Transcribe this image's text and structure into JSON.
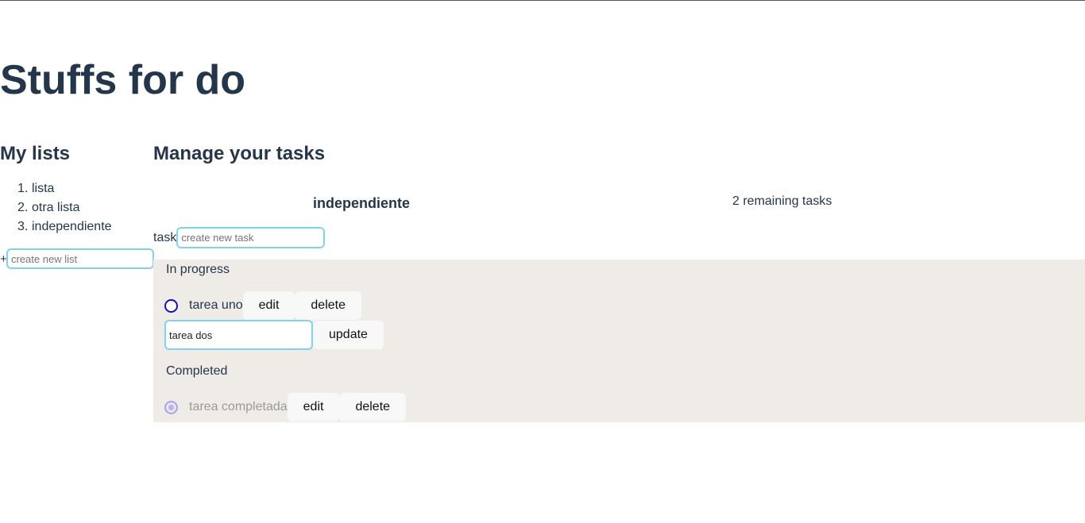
{
  "app": {
    "title": "Stuffs for do"
  },
  "sidebar": {
    "title": "My lists",
    "items": [
      {
        "number": "1.",
        "label": "lista"
      },
      {
        "number": "2.",
        "label": "otra lista"
      },
      {
        "number": "3.",
        "label": "independiente"
      }
    ],
    "new_list": {
      "prefix": "+",
      "placeholder": "create new list",
      "value": ""
    }
  },
  "main": {
    "title": "Manage your tasks",
    "list_name": "independiente",
    "remaining": "2 remaining tasks",
    "new_task": {
      "label": "task",
      "placeholder": "create new task",
      "value": ""
    },
    "in_progress": {
      "label": "In progress",
      "tasks": [
        {
          "text": "tarea uno",
          "edit_label": "edit",
          "delete_label": "delete"
        }
      ],
      "editing": {
        "value": "tarea dos",
        "update_label": "update"
      }
    },
    "completed": {
      "label": "Completed",
      "tasks": [
        {
          "text": "tarea completada",
          "edit_label": "edit",
          "delete_label": "delete"
        }
      ]
    }
  },
  "colors": {
    "heading": "#24364b",
    "panel_bg": "#efece8",
    "input_border": "#7fd3ea",
    "radio_active": "#1010c8",
    "radio_done": "#a9a4e6",
    "button_bg": "#f8f8f8"
  }
}
